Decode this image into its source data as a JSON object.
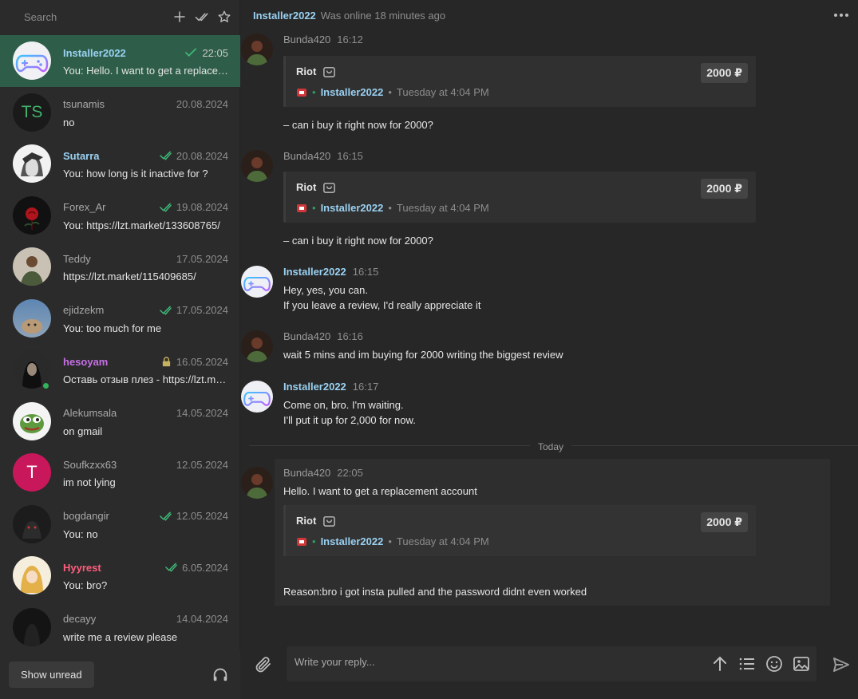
{
  "search": {
    "placeholder": "Search"
  },
  "conversations": [
    {
      "name": "Installer2022",
      "date": "22:05",
      "preview": "You: Hello. I want to get a replacement account",
      "read": true,
      "name_color": "#9ad1f2"
    },
    {
      "name": "tsunamis",
      "date": "20.08.2024",
      "preview": "no",
      "read": false,
      "initials": "TS",
      "name_color": "#a9a9a9"
    },
    {
      "name": "Sutarra",
      "date": "20.08.2024",
      "preview": "You: how long is it inactive for ?",
      "read": true,
      "name_color": "#9ad1f2"
    },
    {
      "name": "Forex_Ar",
      "date": "19.08.2024",
      "preview": "You: https://lzt.market/133608765/",
      "read": true,
      "name_color": "#a9a9a9"
    },
    {
      "name": "Teddy",
      "date": "17.05.2024",
      "preview": "https://lzt.market/115409685/",
      "read": false,
      "name_color": "#a9a9a9"
    },
    {
      "name": "ejidzekm",
      "date": "17.05.2024",
      "preview": "You: too much for me",
      "read": true,
      "name_color": "#a9a9a9"
    },
    {
      "name": "hesoyam",
      "date": "16.05.2024",
      "preview": "Оставь отзыв плез - https://lzt.market/",
      "read": false,
      "locked": true,
      "online": true,
      "name_color": "#c76fe6"
    },
    {
      "name": "Alekumsala",
      "date": "14.05.2024",
      "preview": "on gmail",
      "read": false,
      "name_color": "#a9a9a9"
    },
    {
      "name": "Soufkzxx63",
      "date": "12.05.2024",
      "preview": "im not lying",
      "read": false,
      "initials": "T",
      "name_color": "#a9a9a9"
    },
    {
      "name": "bogdangir",
      "date": "12.05.2024",
      "preview": "You: no",
      "read": true,
      "name_color": "#a9a9a9"
    },
    {
      "name": "Hyyrest",
      "date": "6.05.2024",
      "preview": "You: bro?",
      "read": true,
      "name_color": "#ff5e7e"
    },
    {
      "name": "decayy",
      "date": "14.04.2024",
      "preview": "write me a review please",
      "read": false,
      "name_color": "#a9a9a9"
    }
  ],
  "footer": {
    "show_unread": "Show unread"
  },
  "chat": {
    "peer_name": "Installer2022",
    "peer_status": "Was online 18 minutes ago",
    "today_label": "Today",
    "reply_placeholder": "Write your reply...",
    "messages": [
      {
        "author": "Bunda420",
        "time": "16:12",
        "text": "– can i buy it right now for 2000?"
      },
      {
        "author": "Bunda420",
        "time": "16:15",
        "text": "– can i buy it right now for 2000?"
      },
      {
        "author": "Installer2022",
        "time": "16:15",
        "line1": "Hey, yes, you can.",
        "line2": "If you leave a review, I'd really appreciate it"
      },
      {
        "author": "Bunda420",
        "time": "16:16",
        "text": "wait 5 mins and im buying for 2000 writing the biggest review"
      },
      {
        "author": "Installer2022",
        "time": "16:17",
        "line1": "Come on, bro. I'm waiting.",
        "line2": "I'll put it up for 2,000 for now."
      },
      {
        "author": "Bunda420",
        "time": "22:05",
        "text": "Hello. I want to get a replacement account",
        "reason": "Reason:bro i got insta pulled and the password didnt even worked"
      }
    ],
    "card": {
      "title": "Riot",
      "price": "2000 ₽",
      "seller": "Installer2022",
      "when": "Tuesday at 4:04 PM"
    }
  },
  "colors": {
    "accent": "#9ad1f2",
    "active_row": "#2e5e49",
    "check": "#3fb879"
  }
}
